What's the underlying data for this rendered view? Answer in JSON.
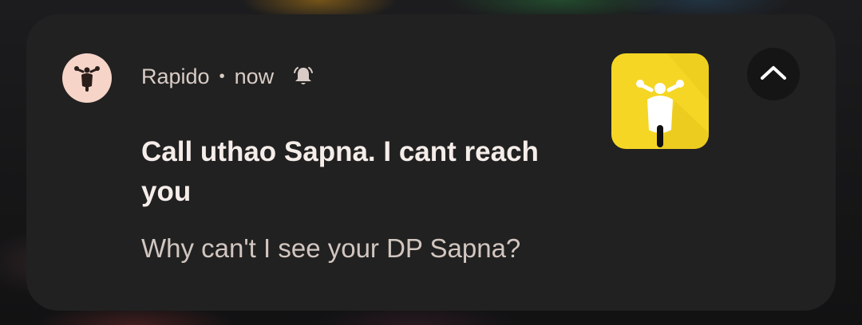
{
  "notification": {
    "app_name": "Rapido",
    "separator": "•",
    "time": "now",
    "title": "Call uthao Sapna. I cant reach you",
    "body": "Why can't I see your DP Sapna?",
    "small_icon": "scooter-icon",
    "large_icon": "rapido-scooter-icon",
    "alert_icon": "bell-ringing-icon",
    "expand_icon": "chevron-up-icon"
  },
  "colors": {
    "card_background": "#212121",
    "app_icon_background": "#f6d4c8",
    "large_icon_background": "#f5d624",
    "title_text": "#f5ede9",
    "body_text": "#d2c6c0"
  }
}
